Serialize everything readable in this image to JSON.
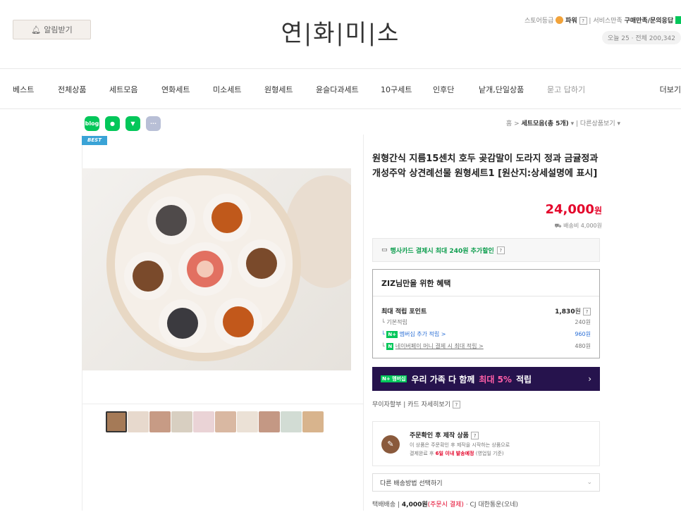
{
  "header": {
    "alarm_label": "알림받기",
    "logo": "연|화|미|소",
    "util_store_grade": "스토어등급",
    "util_tier": "파워",
    "util_help": "?",
    "util_service": "서비스만족",
    "util_qa": "구매만족/문의응답",
    "visits": "오늘 25 · 전체 200,342"
  },
  "nav": {
    "items": [
      "베스트",
      "전체상품",
      "세트모음",
      "연화세트",
      "미소세트",
      "원형세트",
      "윤슬다과세트",
      "10구세트",
      "인후단",
      "낱개,단일상품",
      "묻고 답하기"
    ],
    "more": "더보기"
  },
  "breadcrumb": {
    "home": "홈",
    "current": "세트모음(총 5개)",
    "other": "다른상품보기"
  },
  "share_icons": [
    "blog",
    "band",
    "bookmark",
    "more"
  ],
  "best_badge": "BEST",
  "product": {
    "name": "원형간식 지름15센치 호두 곶감말이 도라지 정과 금귤정과 개성주악 상견례선물 원형세트1 [원산지:상세설명에 표시]",
    "price": "24,000",
    "price_unit": "원",
    "shipping": "배송비 4,000원",
    "card_promo": "행사카드 결제시 최대 240원 추가할인"
  },
  "benefit": {
    "title": "ZIZ님만을 위한 혜택",
    "max_point_label": "최대 적립 포인트",
    "max_point_value": "1,830",
    "max_point_unit": "원",
    "rows": [
      {
        "label": "기본적립",
        "value": "240원"
      },
      {
        "label": "멤버십 추가 적립 >",
        "value": "960원"
      },
      {
        "label": "네이버페이 머니 결제 시 최대 적립 >",
        "value": "480원"
      }
    ]
  },
  "banner": {
    "text_before": "우리 가족 다 함께",
    "highlight": "최대 5%",
    "text_after": "적립",
    "arrow": "›"
  },
  "installment": "무이자할부 | 카드 자세히보기",
  "made_to_order": {
    "title": "주문확인 후 제작 상품",
    "line1": "이 상품은 주문확인 후 제작을 시작하는 상품으로",
    "line2_before": "결제완료 후",
    "line2_highlight": "6일 이내 발송예정",
    "line2_after": "(영업일 기준)"
  },
  "shipping_select": {
    "value": "다른 배송방법 선택하기"
  },
  "delivery": {
    "label": "택배배송",
    "fee": "4,000원",
    "fee_note": "(주문시 결제)",
    "carrier": "· CJ 대한통운(오네)"
  },
  "colors": {
    "price_red": "#e4062b",
    "naver_green": "#03c75a",
    "banner_bg": "#26134d",
    "best_blue": "#3aa3d6"
  }
}
